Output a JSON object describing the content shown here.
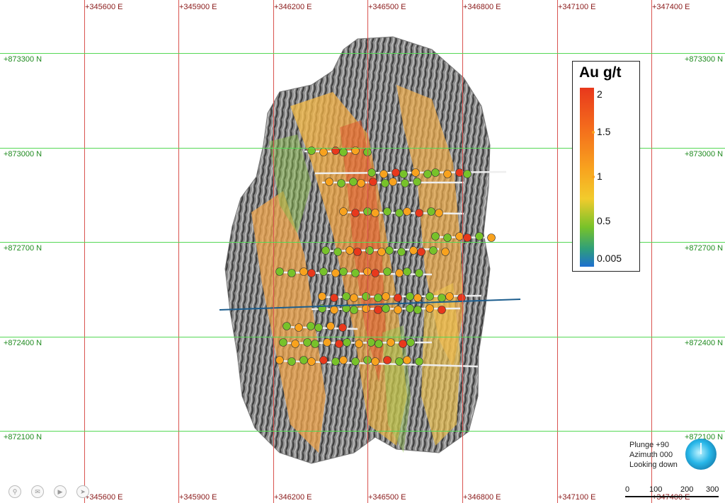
{
  "grid": {
    "easting_labels": [
      "+345600 E",
      "+345900 E",
      "+346200 E",
      "+346500 E",
      "+346800 E",
      "+347100 E",
      "+347400 E"
    ],
    "northing_labels": [
      "+873300 N",
      "+873000 N",
      "+872700 N",
      "+872400 N",
      "+872100 N"
    ]
  },
  "legend": {
    "title": "Au g/t",
    "ticks": [
      "2",
      "1.5",
      "1",
      "0.5",
      "0.005"
    ]
  },
  "view": {
    "plunge": "Plunge +90",
    "azimuth": "Azimuth 000",
    "direction": "Looking down"
  },
  "scale_bar": {
    "ticks": [
      "0",
      "100",
      "200",
      "300"
    ]
  },
  "toolbar": {
    "zoom_icon": "search-icon",
    "chat_icon": "comment-icon",
    "video_icon": "camera-icon",
    "arrow_icon": "arrow-icon"
  },
  "colors": {
    "easting_line": "#d9534f",
    "northing_line": "#55d855",
    "au_high": "#e8381c",
    "au_mid": "#f8a21e",
    "au_low": "#77c22a",
    "au_min": "#1e6fd0",
    "section_line": "#1d5e8e"
  }
}
